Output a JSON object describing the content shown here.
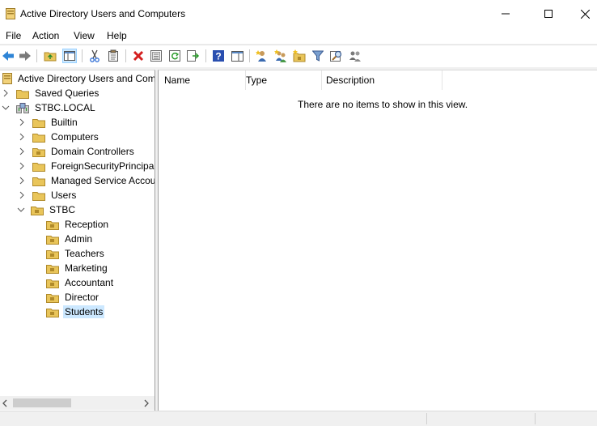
{
  "window": {
    "title": "Active Directory Users and Computers",
    "controls": [
      "minimize",
      "maximize",
      "close"
    ]
  },
  "menu": [
    "File",
    "Action",
    "View",
    "Help"
  ],
  "toolbar": {
    "buttons": [
      "back",
      "forward",
      "up-level",
      "show-hide-console-tree",
      "cut",
      "copy",
      "delete",
      "properties",
      "refresh",
      "export-list",
      "help",
      "show-hide-action-pane",
      "create-user",
      "create-group",
      "create-ou",
      "filter",
      "find",
      "delegate-control"
    ]
  },
  "tree": {
    "root": "Active Directory Users and Computers",
    "saved_queries": "Saved Queries",
    "domain": "STBC.LOCAL",
    "containers": [
      "Builtin",
      "Computers",
      "Domain Controllers",
      "ForeignSecurityPrincipals",
      "Managed Service Accounts",
      "Users"
    ],
    "ou": "STBC",
    "children": [
      "Reception",
      "Admin",
      "Teachers",
      "Marketing",
      "Accountant",
      "Director",
      "Students"
    ],
    "selected": "Students"
  },
  "details": {
    "columns": [
      "Name",
      "Type",
      "Description"
    ],
    "empty_message": "There are no items to show in this view."
  },
  "colors": {
    "folder": "#e9c55a",
    "folder_dark": "#b08a2a",
    "selection": "#cce8ff",
    "back_arrow": "#2e84d6"
  }
}
